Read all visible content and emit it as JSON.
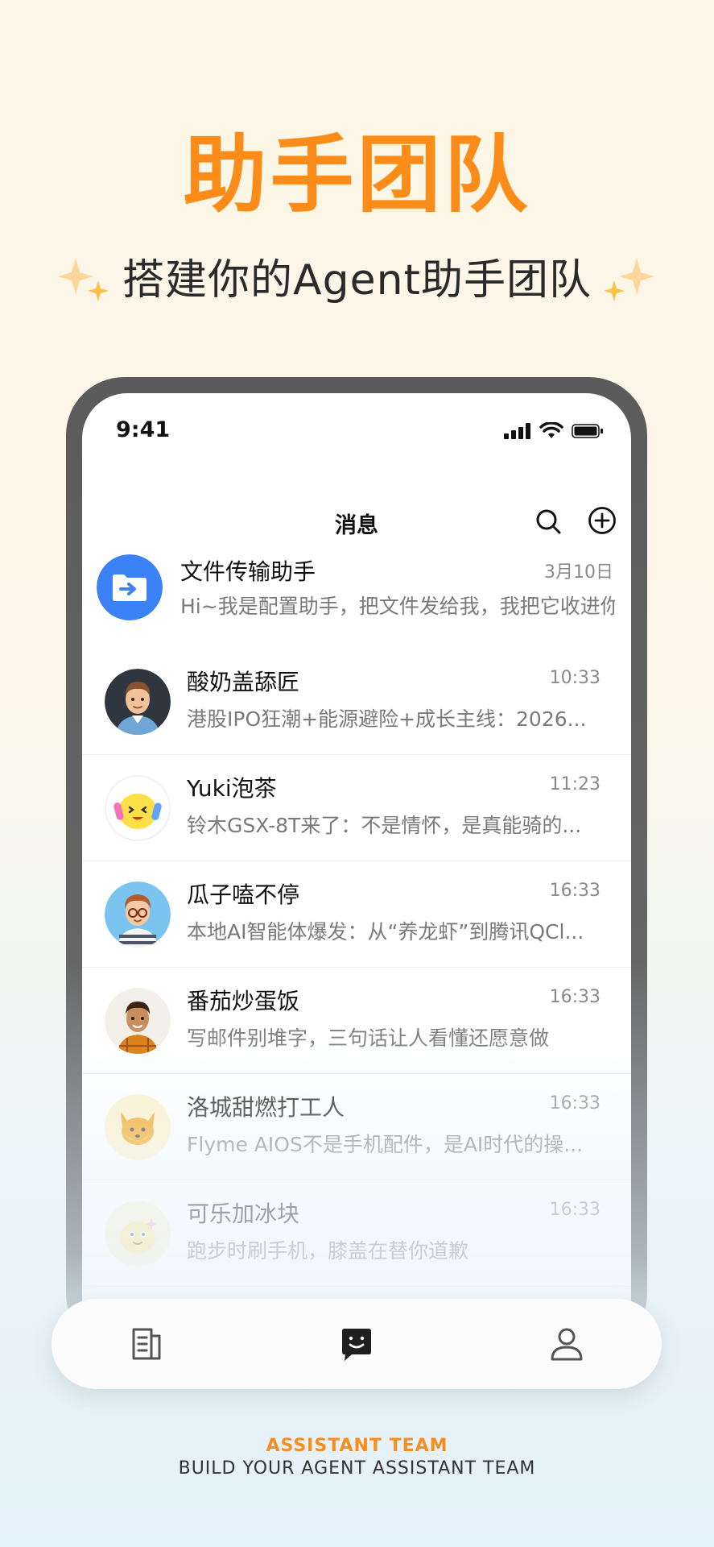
{
  "hero": {
    "title": "助手团队",
    "subtitle": "搭建你的Agent助手团队"
  },
  "status_bar": {
    "time": "9:41",
    "icons": [
      "signal-icon",
      "wifi-icon",
      "battery-icon"
    ]
  },
  "nav": {
    "title": "消息",
    "search_icon": "search-icon",
    "add_icon": "add-circle-icon"
  },
  "messages": [
    {
      "name": "文件传输助手",
      "time": "3月10日",
      "preview": "Hi~我是配置助手，把文件发给我，我把它收进你...",
      "avatar": "folder-icon"
    },
    {
      "name": "酸奶盖舔匠",
      "time": "10:33",
      "preview": "港股IPO狂潮+能源避险+成长主线：2026...",
      "avatar": "man-avatar"
    },
    {
      "name": "Yuki泡茶",
      "time": "11:23",
      "preview": "铃木GSX-8T来了：不是情怀，是真能骑的...",
      "avatar": "smiley-avatar"
    },
    {
      "name": "瓜子嗑不停",
      "time": "16:33",
      "preview": "本地AI智能体爆发：从“养龙虾”到腾讯QCl...",
      "avatar": "glasses-boy-avatar"
    },
    {
      "name": "番茄炒蛋饭",
      "time": "16:33",
      "preview": "写邮件别堆字，三句话让人看懂还愿意做",
      "avatar": "boy-avatar"
    },
    {
      "name": "洛城甜燃打工人",
      "time": "16:33",
      "preview": "Flyme AIOS不是手机配件，是AI时代的操...",
      "avatar": "fox-avatar"
    },
    {
      "name": "可乐加冰块",
      "time": "16:33",
      "preview": "跑步时刷手机，膝盖在替你道歉",
      "avatar": "blob-avatar"
    }
  ],
  "tabbar": {
    "tabs": [
      "contacts-icon",
      "chat-icon",
      "profile-icon"
    ],
    "active": "chat-icon"
  },
  "footer": {
    "line1": "ASSISTANT TEAM",
    "line2": "BUILD YOUR AGENT ASSISTANT TEAM"
  },
  "colors": {
    "accent": "#fb8c1a",
    "folder_blue": "#3b82f6"
  }
}
